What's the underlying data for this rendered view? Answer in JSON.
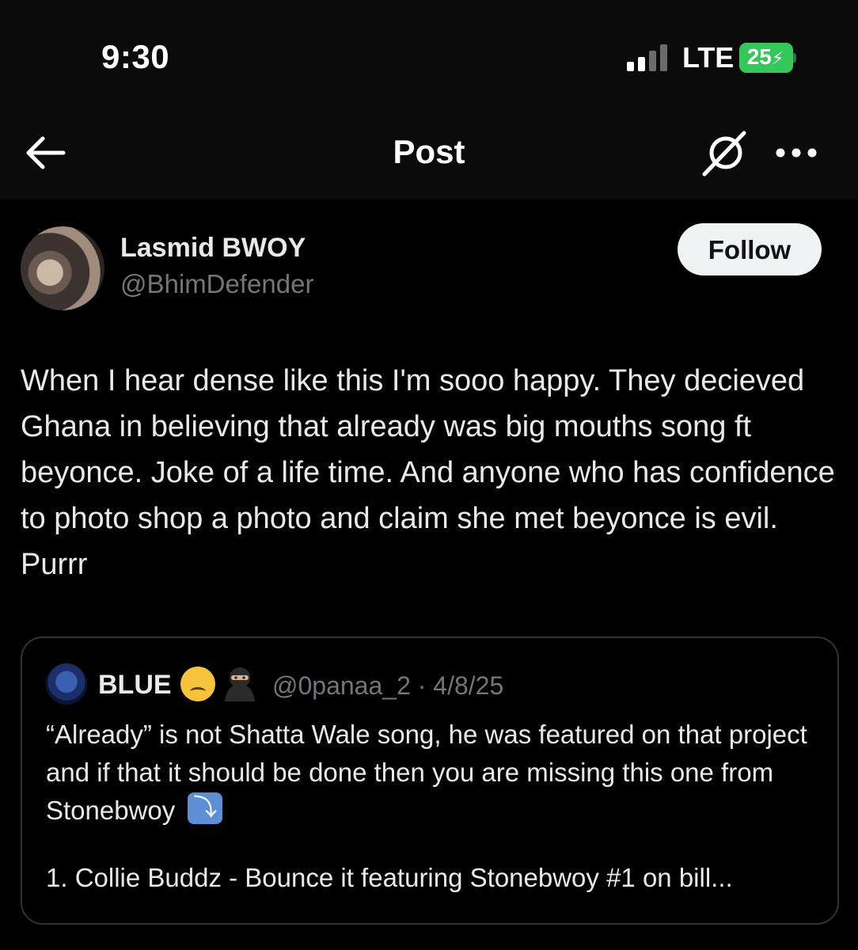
{
  "status": {
    "time": "9:30",
    "network": "LTE",
    "battery": "25",
    "signal_bars_active": 2,
    "signal_bars_total": 4,
    "battery_color": "#34c759"
  },
  "nav": {
    "title": "Post",
    "back_icon": "arrow-left-icon",
    "grok_icon": "grok-slash-icon",
    "more_icon": "more-dots-icon"
  },
  "post": {
    "author_name": "Lasmid BWOY",
    "author_handle": "@BhimDefender",
    "follow_label": "Follow",
    "text": "When I hear dense like this I'm sooo happy. They decieved Ghana in believing that already was big mouths song ft beyonce. Joke of a life time. And anyone who has confidence to photo shop a photo and claim she met beyonce is evil. Purrr"
  },
  "quote": {
    "name": "BLUE",
    "emoji_1": "crying-face",
    "emoji_2": "ninja",
    "handle_date": "@0panaa_2 · 4/8/25",
    "text": "“Already” is not Shatta Wale song, he was featured on that project and if that it should be done then you are missing this one from Stonebwoy",
    "arrow_emoji": "arrow-down-right-emoji",
    "list_line": "1. Collie Buddz - Bounce it featuring Stonebwoy #1 on bill..."
  },
  "colors": {
    "background": "#000000",
    "text": "#e7e9ea",
    "secondary_text": "#71767b",
    "border": "#2f3336",
    "follow_bg": "#eff3f4"
  }
}
